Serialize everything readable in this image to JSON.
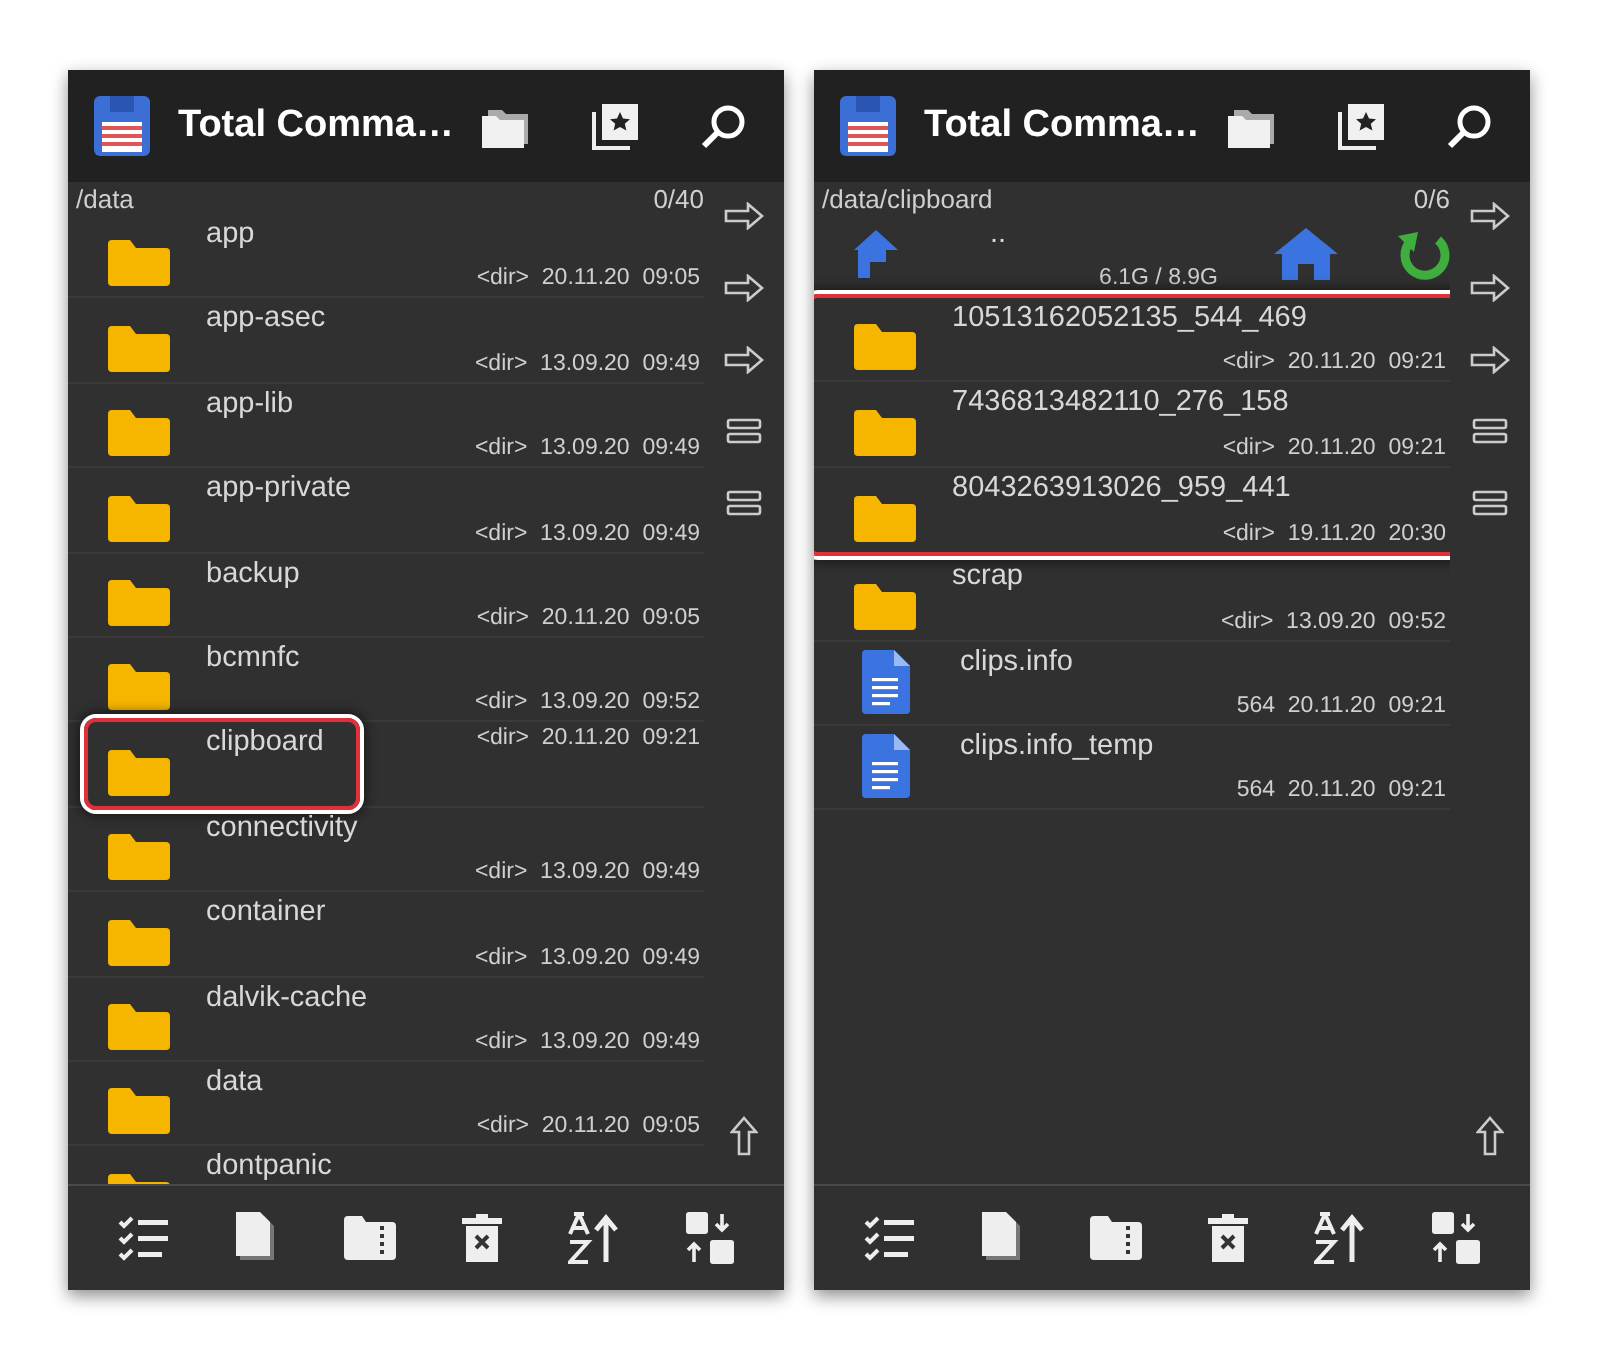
{
  "panels": [
    {
      "title": "Total Comma…",
      "path": "/data",
      "count": "0/40",
      "highlight_whole_rows": false,
      "items": [
        {
          "kind": "folder",
          "name": "app",
          "meta": "<dir>  20.11.20  09:05",
          "highlighted": false
        },
        {
          "kind": "folder",
          "name": "app-asec",
          "meta": "<dir>  13.09.20  09:49",
          "highlighted": false
        },
        {
          "kind": "folder",
          "name": "app-lib",
          "meta": "<dir>  13.09.20  09:49",
          "highlighted": false
        },
        {
          "kind": "folder",
          "name": "app-private",
          "meta": "<dir>  13.09.20  09:49",
          "highlighted": false
        },
        {
          "kind": "folder",
          "name": "backup",
          "meta": "<dir>  20.11.20  09:05",
          "highlighted": false
        },
        {
          "kind": "folder",
          "name": "bcmnfc",
          "meta": "<dir>  13.09.20  09:52",
          "highlighted": false
        },
        {
          "kind": "folder",
          "name": "clipboard",
          "meta": "<dir>  20.11.20  09:21",
          "highlighted": true
        },
        {
          "kind": "folder",
          "name": "connectivity",
          "meta": "<dir>  13.09.20  09:49",
          "highlighted": false
        },
        {
          "kind": "folder",
          "name": "container",
          "meta": "<dir>  13.09.20  09:49",
          "highlighted": false
        },
        {
          "kind": "folder",
          "name": "dalvik-cache",
          "meta": "<dir>  13.09.20  09:49",
          "highlighted": false
        },
        {
          "kind": "folder",
          "name": "data",
          "meta": "<dir>  20.11.20  09:05",
          "highlighted": false
        },
        {
          "kind": "folder",
          "name": "dontpanic",
          "highlighted": false
        }
      ]
    },
    {
      "title": "Total Comma…",
      "path": "/data/clipboard",
      "count": "0/6",
      "highlight_whole_rows": true,
      "items": [
        {
          "kind": "parent",
          "name": "..",
          "meta": "6.1G / 8.9G",
          "highlighted": false
        },
        {
          "kind": "folder",
          "name": "10513162052135_544_469",
          "meta": "<dir>  20.11.20  09:21",
          "highlighted": true
        },
        {
          "kind": "folder",
          "name": "7436813482110_276_158",
          "meta": "<dir>  20.11.20  09:21",
          "highlighted": true
        },
        {
          "kind": "folder",
          "name": "8043263913026_959_441",
          "meta": "<dir>  19.11.20  20:30",
          "highlighted": true
        },
        {
          "kind": "folder",
          "name": "scrap",
          "meta": "<dir>  13.09.20  09:52",
          "highlighted": false
        },
        {
          "kind": "file",
          "name": "clips.info",
          "meta": "564  20.11.20  09:21",
          "highlighted": false
        },
        {
          "kind": "file",
          "name": "clips.info_temp",
          "meta": "564  20.11.20  09:21",
          "highlighted": false
        }
      ]
    }
  ]
}
